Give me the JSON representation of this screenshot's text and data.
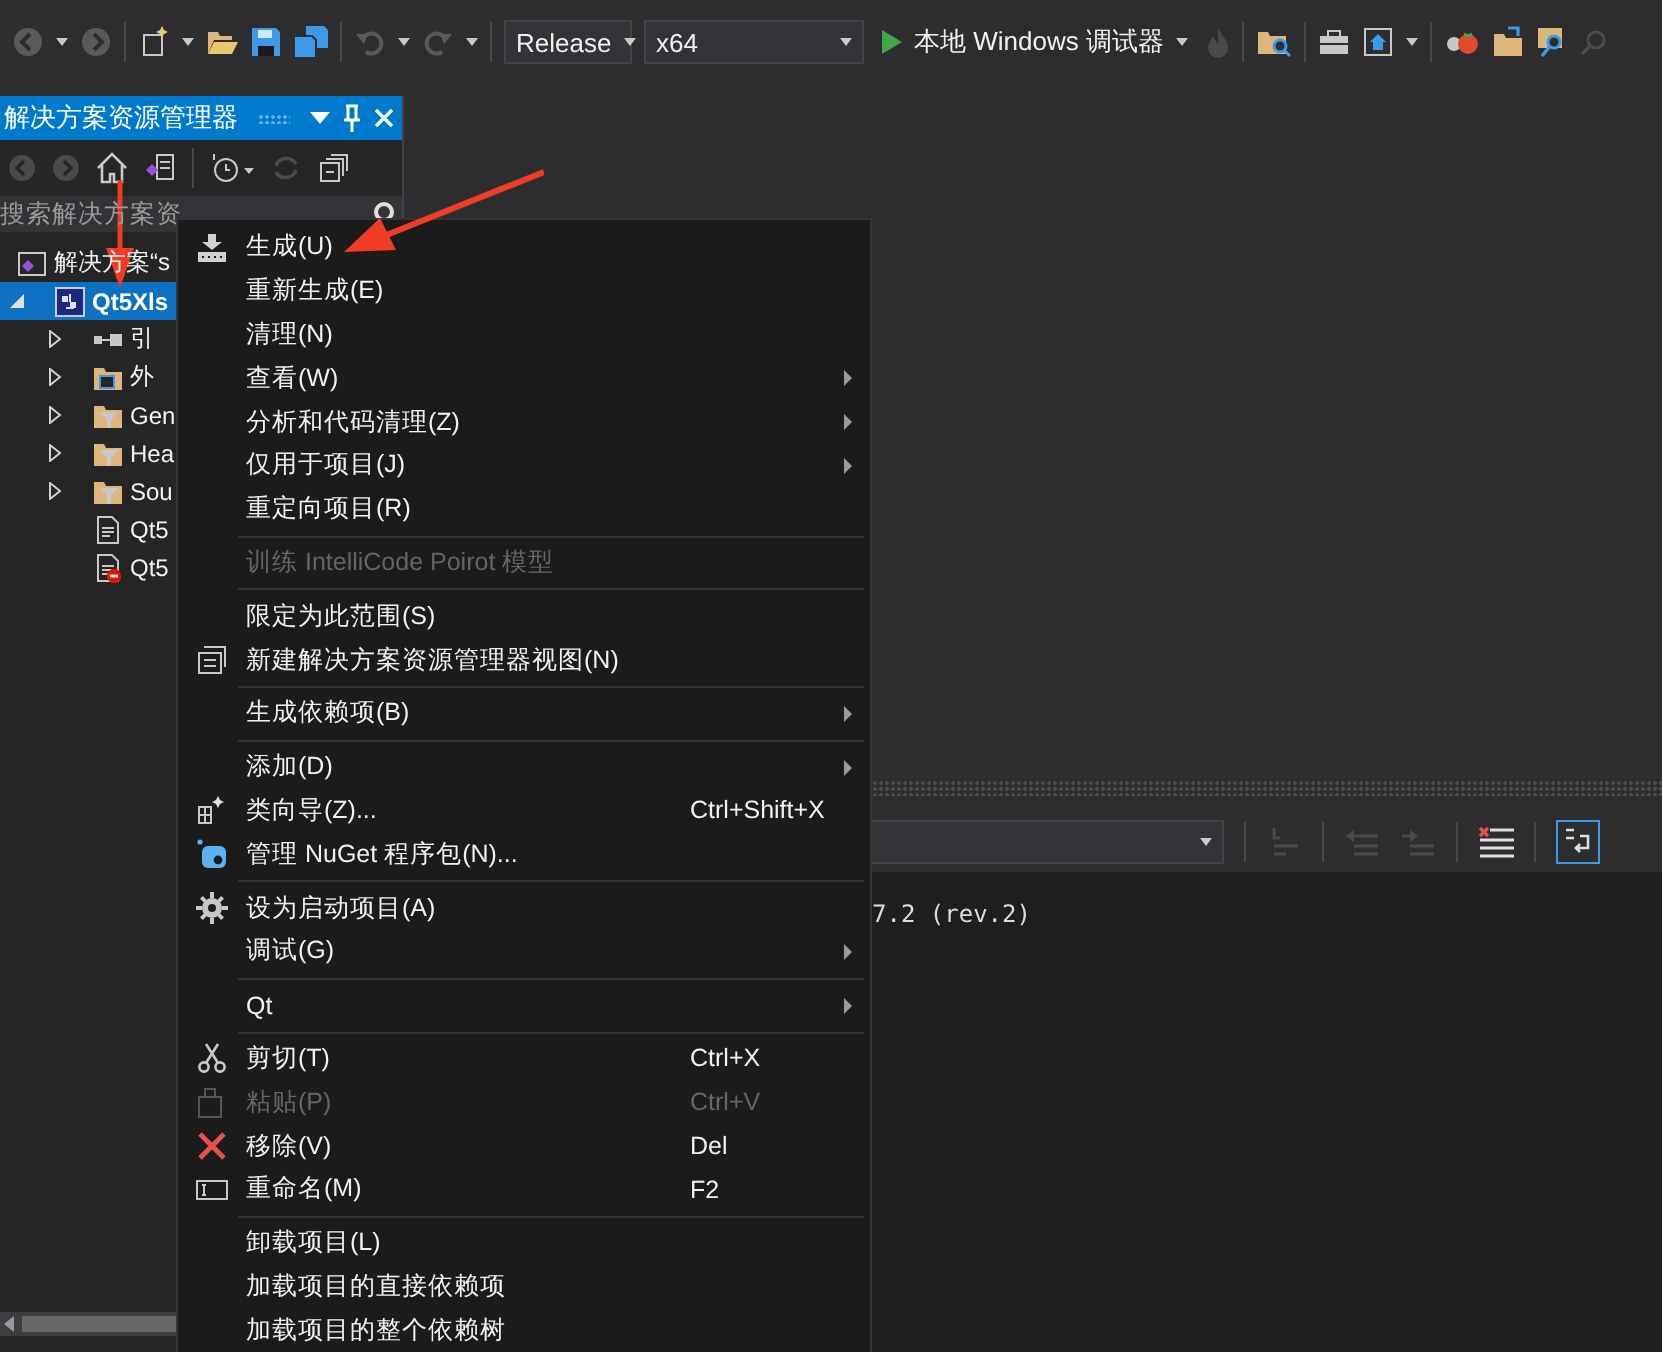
{
  "toolbar": {
    "configuration": "Release",
    "platform": "x64",
    "run_label": "本地 Windows 调试器"
  },
  "solution_explorer": {
    "title": "解决方案资源管理器",
    "search": {
      "placeholder": "搜索解决方案资"
    },
    "tree": [
      {
        "label": "解决方案“s",
        "kind": "solution",
        "selected": false,
        "children": [
          {
            "label": "Qt5Xls",
            "kind": "project",
            "expanded": true,
            "selected": true,
            "children": [
              {
                "label": "引",
                "kind": "references",
                "expanded": false,
                "selected": false
              },
              {
                "label": "外",
                "kind": "external",
                "expanded": false,
                "selected": false
              },
              {
                "label": "Gen",
                "kind": "filter",
                "expanded": false,
                "selected": false
              },
              {
                "label": "Hea",
                "kind": "filter",
                "expanded": false,
                "selected": false
              },
              {
                "label": "Sou",
                "kind": "filter",
                "expanded": false,
                "selected": false
              },
              {
                "label": "Qt5",
                "kind": "file",
                "error": false,
                "selected": false
              },
              {
                "label": "Qt5",
                "kind": "file",
                "error": true,
                "selected": false
              }
            ]
          }
        ]
      }
    ]
  },
  "context_menu": {
    "items": [
      {
        "kind": "item",
        "label": "生成(U)",
        "submenu": false,
        "disabled": false
      },
      {
        "kind": "item",
        "label": "重新生成(E)",
        "submenu": false,
        "disabled": false
      },
      {
        "kind": "item",
        "label": "清理(N)",
        "submenu": false,
        "disabled": false
      },
      {
        "kind": "item",
        "label": "查看(W)",
        "submenu": true,
        "disabled": false
      },
      {
        "kind": "item",
        "label": "分析和代码清理(Z)",
        "submenu": true,
        "disabled": false
      },
      {
        "kind": "item",
        "label": "仅用于项目(J)",
        "submenu": true,
        "disabled": false
      },
      {
        "kind": "item",
        "label": "重定向项目(R)",
        "submenu": false,
        "disabled": false
      },
      {
        "kind": "separator"
      },
      {
        "kind": "item",
        "label": "训练 IntelliCode Poirot 模型",
        "submenu": false,
        "disabled": true
      },
      {
        "kind": "separator"
      },
      {
        "kind": "item",
        "label": "限定为此范围(S)",
        "submenu": false,
        "disabled": false
      },
      {
        "kind": "item",
        "label": "新建解决方案资源管理器视图(N)",
        "submenu": false,
        "disabled": false
      },
      {
        "kind": "separator"
      },
      {
        "kind": "item",
        "label": "生成依赖项(B)",
        "submenu": true,
        "disabled": false
      },
      {
        "kind": "separator"
      },
      {
        "kind": "item",
        "label": "添加(D)",
        "submenu": true,
        "disabled": false
      },
      {
        "kind": "item",
        "label": "类向导(Z)...",
        "shortcut": "Ctrl+Shift+X",
        "submenu": false,
        "disabled": false
      },
      {
        "kind": "item",
        "label": "管理 NuGet 程序包(N)...",
        "submenu": false,
        "disabled": false
      },
      {
        "kind": "separator"
      },
      {
        "kind": "item",
        "label": "设为启动项目(A)",
        "submenu": false,
        "disabled": false
      },
      {
        "kind": "item",
        "label": "调试(G)",
        "submenu": true,
        "disabled": false
      },
      {
        "kind": "separator"
      },
      {
        "kind": "item",
        "label": "Qt",
        "submenu": true,
        "disabled": false
      },
      {
        "kind": "separator"
      },
      {
        "kind": "item",
        "label": "剪切(T)",
        "shortcut": "Ctrl+X",
        "submenu": false,
        "disabled": false
      },
      {
        "kind": "item",
        "label": "粘贴(P)",
        "shortcut": "Ctrl+V",
        "submenu": false,
        "disabled": true
      },
      {
        "kind": "item",
        "label": "移除(V)",
        "shortcut": "Del",
        "submenu": false,
        "disabled": false
      },
      {
        "kind": "item",
        "label": "重命名(M)",
        "shortcut": "F2",
        "submenu": false,
        "disabled": false
      },
      {
        "kind": "separator"
      },
      {
        "kind": "item",
        "label": "卸载项目(L)",
        "submenu": false,
        "disabled": false
      },
      {
        "kind": "item",
        "label": "加载项目的直接依赖项",
        "submenu": false,
        "disabled": false
      },
      {
        "kind": "item",
        "label": "加载项目的整个依赖树",
        "submenu": false,
        "disabled": false
      }
    ]
  },
  "output": {
    "text": "7.2 (rev.2)"
  }
}
